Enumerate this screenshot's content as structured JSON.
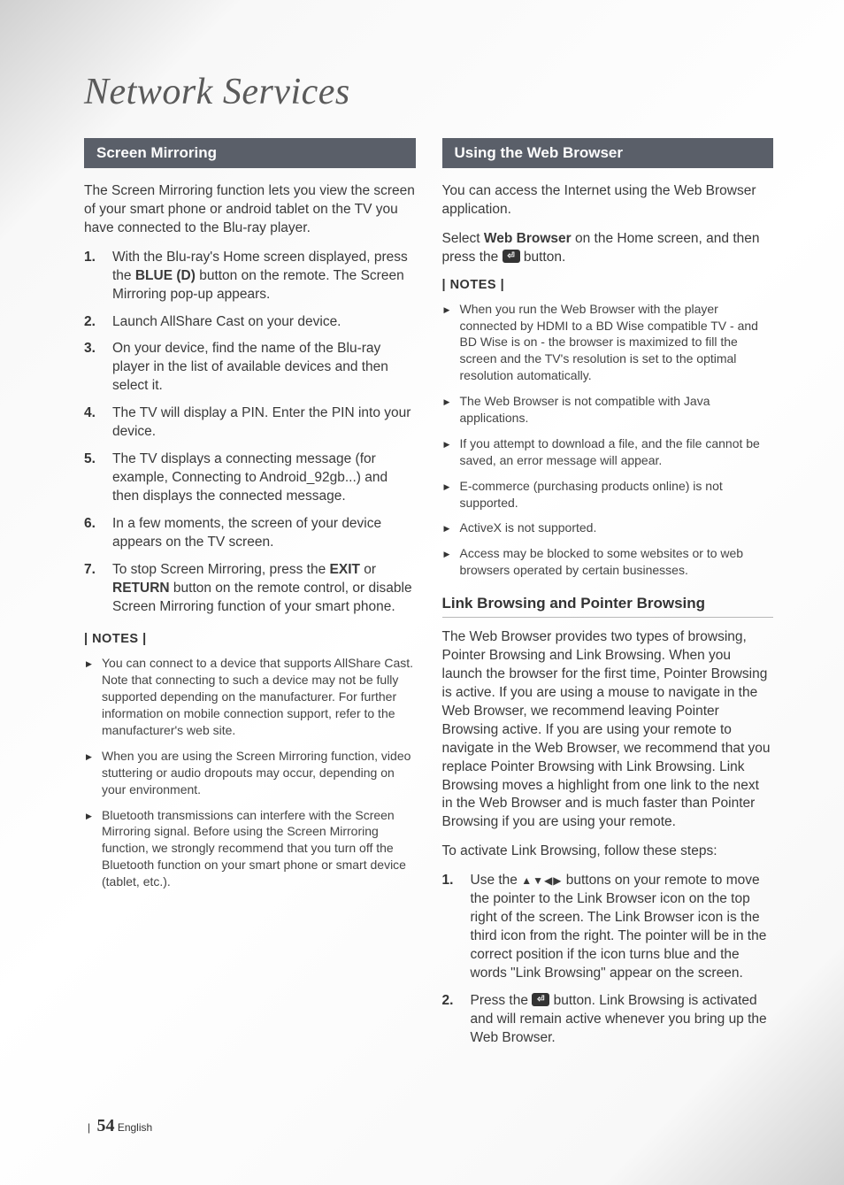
{
  "page_title": "Network Services",
  "footer": {
    "page_number": "54",
    "language": "English"
  },
  "left": {
    "header": "Screen Mirroring",
    "intro": "The Screen Mirroring function lets you view the screen of your smart phone or android tablet on the TV you have connected to the Blu-ray player.",
    "steps": [
      {
        "pre": "With the Blu-ray's Home screen displayed, press the ",
        "bold1": "BLUE (D)",
        "post": " button on the remote. The Screen Mirroring pop-up appears."
      },
      {
        "text": "Launch AllShare Cast on your device."
      },
      {
        "text": "On your device, find the name of the Blu-ray player in the list of available devices and then select it."
      },
      {
        "text": "The TV will display a PIN. Enter the PIN into your device."
      },
      {
        "text": "The TV displays a connecting message (for example, Connecting to Android_92gb...) and then displays the connected message."
      },
      {
        "text": "In a few moments, the screen of your device appears on the TV screen."
      },
      {
        "pre": "To stop Screen Mirroring, press the ",
        "bold1": "EXIT",
        "mid": " or ",
        "bold2": "RETURN",
        "post": " button on the remote control, or disable Screen Mirroring function of your smart phone."
      }
    ],
    "notes_label": "| NOTES |",
    "notes": [
      "You can connect to a device that supports AllShare Cast. Note that connecting to such a device may not be fully supported depending on the manufacturer. For further information on mobile connection support, refer to the manufacturer's web site.",
      "When you are using the Screen Mirroring function, video stuttering or audio dropouts may occur, depending on your environment.",
      "Bluetooth transmissions can interfere with the Screen Mirroring signal. Before using the Screen Mirroring function, we strongly recommend that you turn off the Bluetooth function on your smart phone or smart device (tablet, etc.)."
    ]
  },
  "right": {
    "header": "Using the Web Browser",
    "intro1": "You can access the Internet using the Web Browser application.",
    "intro2_pre": "Select ",
    "intro2_bold": "Web Browser",
    "intro2_mid": " on the Home screen, and then press the ",
    "intro2_post": " button.",
    "notes_label": "| NOTES |",
    "notes": [
      "When you run the Web Browser with the player connected by HDMI to a BD Wise compatible TV - and BD Wise is on - the browser is maximized to fill the screen and the TV's resolution is set to the optimal resolution automatically.",
      "The Web Browser is not compatible with Java applications.",
      "If you attempt to download a file, and the file cannot be saved, an error message will appear.",
      "E-commerce (purchasing products online) is not supported.",
      "ActiveX is not supported.",
      "Access may be blocked to some websites or to web browsers operated by certain businesses."
    ],
    "sub_heading": "Link Browsing and Pointer Browsing",
    "sub_body": "The Web Browser provides two types of browsing, Pointer Browsing and Link Browsing. When you launch the browser for the first time, Pointer Browsing is active. If you are using a mouse to navigate in the Web Browser, we recommend leaving Pointer Browsing active. If you are using your remote to navigate in the Web Browser, we recommend that you replace Pointer Browsing with Link Browsing. Link Browsing moves a highlight from one link to the next in the Web Browser and is much faster than Pointer Browsing if you are using your remote.",
    "sub_lead": "To activate Link Browsing, follow these steps:",
    "sub_steps": [
      {
        "pre": "Use the ",
        "dpad": "▲▼◀▶",
        "post": " buttons on your remote to move the pointer to the Link Browser icon on the top right of the screen. The Link Browser icon is the third icon from the right. The pointer will be in the correct position if the icon turns blue and the words \"Link Browsing\" appear on the screen."
      },
      {
        "pre": "Press the ",
        "post": " button. Link Browsing is activated and will remain active whenever you bring up the Web Browser."
      }
    ]
  }
}
